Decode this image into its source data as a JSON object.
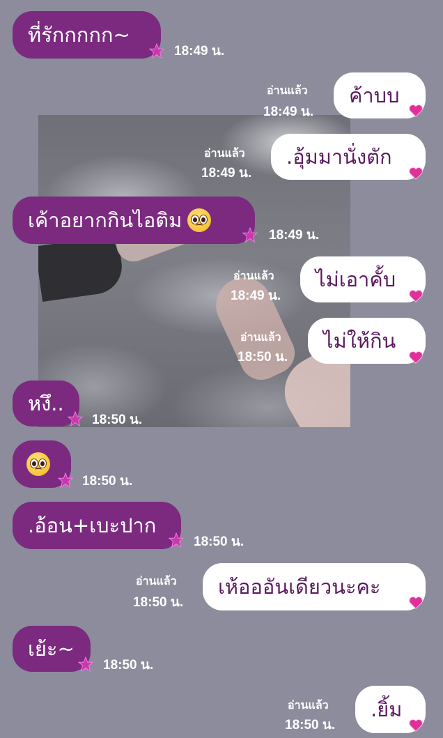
{
  "messages": [
    {
      "side": "in",
      "text": "ที่รักกกกก~",
      "time": "18:49 น."
    },
    {
      "side": "out",
      "text": "ค้าบบ",
      "read": "อ่านแล้ว",
      "time": "18:49 น."
    },
    {
      "side": "out",
      "text": ".อุ้มมานั่งตัก",
      "read": "อ่านแล้ว",
      "time": "18:49 น."
    },
    {
      "side": "in",
      "text": "เค้าอยากกินไอติม",
      "emoji": "pleading-face-icon",
      "time": "18:49 น."
    },
    {
      "side": "out",
      "text": "ไม่เอาคั้บ",
      "read": "อ่านแล้ว",
      "time": "18:49 น."
    },
    {
      "side": "out",
      "text": "ไม่ให้กิน",
      "read": "อ่านแล้ว",
      "time": "18:50 น."
    },
    {
      "side": "in",
      "text": "หงึ..",
      "time": "18:50 น."
    },
    {
      "side": "in",
      "text": "",
      "emoji": "pleading-face-icon",
      "time": "18:50 น."
    },
    {
      "side": "in",
      "text": ".อ้อน+เบะปาก",
      "time": "18:50 น."
    },
    {
      "side": "out",
      "text": "เห้อออันเดียวนะคะ",
      "read": "อ่านแล้ว",
      "time": "18:50 น."
    },
    {
      "side": "in",
      "text": "เย้ะ~",
      "time": "18:50 น."
    },
    {
      "side": "out",
      "text": ".ยิ้ม",
      "read": "อ่านแล้ว",
      "time": "18:50 น."
    }
  ],
  "colors": {
    "background": "#8c8c9c",
    "incoming_bubble": "#7b2a7f",
    "outgoing_bubble": "#ffffff",
    "outgoing_text": "#5a1a5e",
    "incoming_sticker": "star-sticker-icon",
    "outgoing_sticker": "heart-sticker-icon"
  }
}
